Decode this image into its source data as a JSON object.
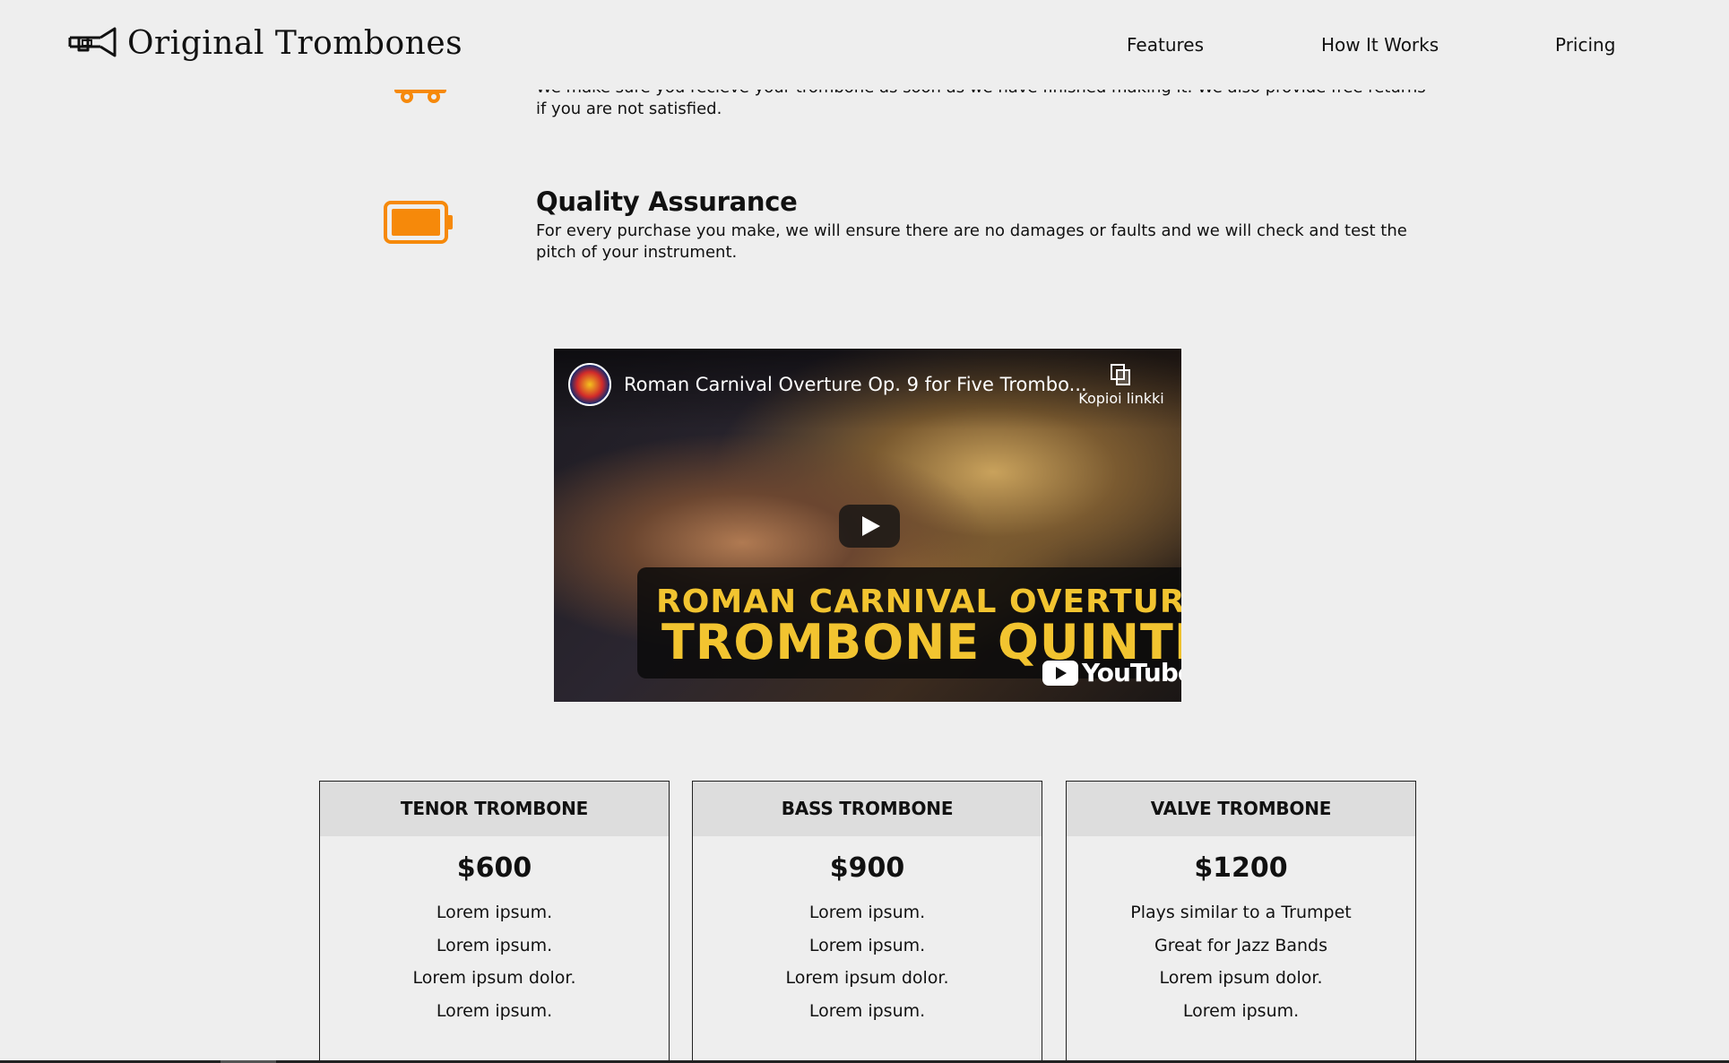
{
  "header": {
    "brand": "Original Trombones",
    "nav": [
      "Features",
      "How It Works",
      "Pricing"
    ]
  },
  "features": [
    {
      "icon": "truck-icon",
      "text": "We make sure you recieve your trombone as soon as we have finished making it. We also provide free returns if you are not satisfied."
    },
    {
      "icon": "battery-icon",
      "title": "Quality Assurance",
      "text": "For every purchase you make, we will ensure there are no damages or faults and we will check and test the pitch of your instrument."
    }
  ],
  "video": {
    "title": "Roman Carnival Overture Op. 9 for Five Trombo...",
    "copy_link": "Kopioi linkki",
    "overlay_line1": "ROMAN CARNIVAL OVERTURE",
    "overlay_line2": "TROMBONE QUINTET",
    "platform": "YouTube"
  },
  "pricing": [
    {
      "name": "TENOR TROMBONE",
      "price": "$600",
      "items": [
        "Lorem ipsum.",
        "Lorem ipsum.",
        "Lorem ipsum dolor.",
        "Lorem ipsum."
      ]
    },
    {
      "name": "BASS TROMBONE",
      "price": "$900",
      "items": [
        "Lorem ipsum.",
        "Lorem ipsum.",
        "Lorem ipsum dolor.",
        "Lorem ipsum."
      ]
    },
    {
      "name": "VALVE TROMBONE",
      "price": "$1200",
      "items": [
        "Plays similar to a Trumpet",
        "Great for Jazz Bands",
        "Lorem ipsum dolor.",
        "Lorem ipsum."
      ]
    }
  ],
  "colors": {
    "accent": "#f6890a",
    "background": "#eeeeee",
    "card_header": "#dddddd",
    "video_text": "#f2c430"
  }
}
